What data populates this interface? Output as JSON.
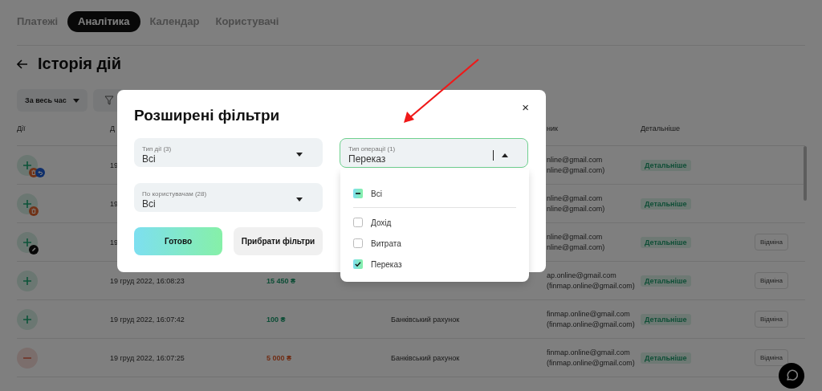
{
  "nav": {
    "tabs": [
      {
        "label": "Платежі",
        "selected": false
      },
      {
        "label": "Аналітика",
        "selected": true
      },
      {
        "label": "Календар",
        "selected": false
      },
      {
        "label": "Користувачі",
        "selected": false
      }
    ]
  },
  "page": {
    "title": "Історія дій"
  },
  "toolbar": {
    "period": "За весь час"
  },
  "table": {
    "header": {
      "column_1": "Дії",
      "column_2": "Д",
      "column_5": "ник",
      "column_6": "Детальніше"
    },
    "rows": [
      {
        "kind": "income",
        "badges": [
          {
            "kind": "delete"
          },
          {
            "kind": "undo"
          }
        ],
        "date": "19",
        "user": [
          "nline@gmail.com",
          "nline@gmail.com)"
        ],
        "details": "Детальніше"
      },
      {
        "kind": "income",
        "badges": [
          {
            "kind": "delete"
          }
        ],
        "date": "19",
        "user": [
          "nline@gmail.com",
          "nline@gmail.com)"
        ],
        "details": "Детальніше"
      },
      {
        "kind": "income",
        "badges": [
          {
            "kind": "edit"
          }
        ],
        "date": "19",
        "user": [
          "nline@gmail.com",
          "nline@gmail.com)"
        ],
        "details": "Детальніше",
        "cancel": "Відміна"
      },
      {
        "kind": "income",
        "badges": [],
        "date": "19 груд 2022, 16:08:23",
        "amount": "15 450 ₴",
        "user": [
          "ap.online@gmail.com",
          "(finmap.online@gmail.com)"
        ],
        "details": "Детальніше",
        "cancel": "Відміна"
      },
      {
        "kind": "income",
        "badges": [],
        "date": "19 груд 2022, 16:07:42",
        "amount": "100 ₴",
        "account": "Банківський рахунок",
        "user": [
          "finmap.online@gmail.com",
          "(finmap.online@gmail.com)"
        ],
        "details": "Детальніше",
        "cancel": "Відміна"
      },
      {
        "kind": "expense",
        "badges": [],
        "date": "19 груд 2022, 16:07:25",
        "amount": "5 000 ₴",
        "account": "Банківський рахунок",
        "user": [
          "finmap.online@gmail.com",
          "(finmap.online@gmail.com)"
        ],
        "details": "Детальніше",
        "cancel": "Відміна"
      }
    ]
  },
  "modal": {
    "title": "Розширені фільтри",
    "close": "×",
    "filters": [
      {
        "label": "Тип дії (3)",
        "value": "Всі"
      },
      {
        "label": "По користувачам (28)",
        "value": "Всі"
      }
    ],
    "done": "Готово",
    "reset": "Прибрати фільтри",
    "operation_type": {
      "label": "Тип операції (1)",
      "value": "Переказ",
      "expanded": true,
      "options": [
        {
          "label": "Всі",
          "checked": false,
          "indeterminate": true
        },
        {
          "label": "Дохід",
          "checked": false,
          "indeterminate": false
        },
        {
          "label": "Витрата",
          "checked": false,
          "indeterminate": false
        },
        {
          "label": "Переказ",
          "checked": true,
          "indeterminate": false
        }
      ]
    }
  }
}
